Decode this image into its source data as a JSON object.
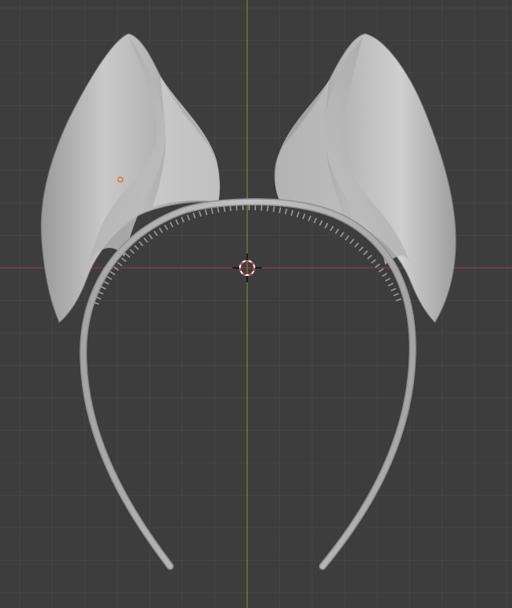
{
  "viewport": {
    "background": "#3d3d3d",
    "grid_minor_color": "#454545",
    "grid_major_color": "#4a4a4a",
    "x_axis_color": "#8a3b46",
    "y_axis_color": "#6e8b2a",
    "origin_color": "#e07a1a",
    "show_grid": true
  },
  "scene": {
    "objects": [
      {
        "name_icon": "ear-left-mesh",
        "shading": "solid-grey"
      },
      {
        "name_icon": "ear-right-mesh",
        "shading": "solid-grey"
      },
      {
        "name_icon": "headband-mesh",
        "shading": "solid-grey"
      }
    ],
    "mesh_color": "#b8b8b8",
    "mesh_shadow_color": "#6e6e6e",
    "mesh_highlight_color": "#d9d9d9"
  },
  "cursor": {
    "icon": "3d-cursor-icon",
    "ring_colors": [
      "#ffffff",
      "#d9393d"
    ]
  }
}
